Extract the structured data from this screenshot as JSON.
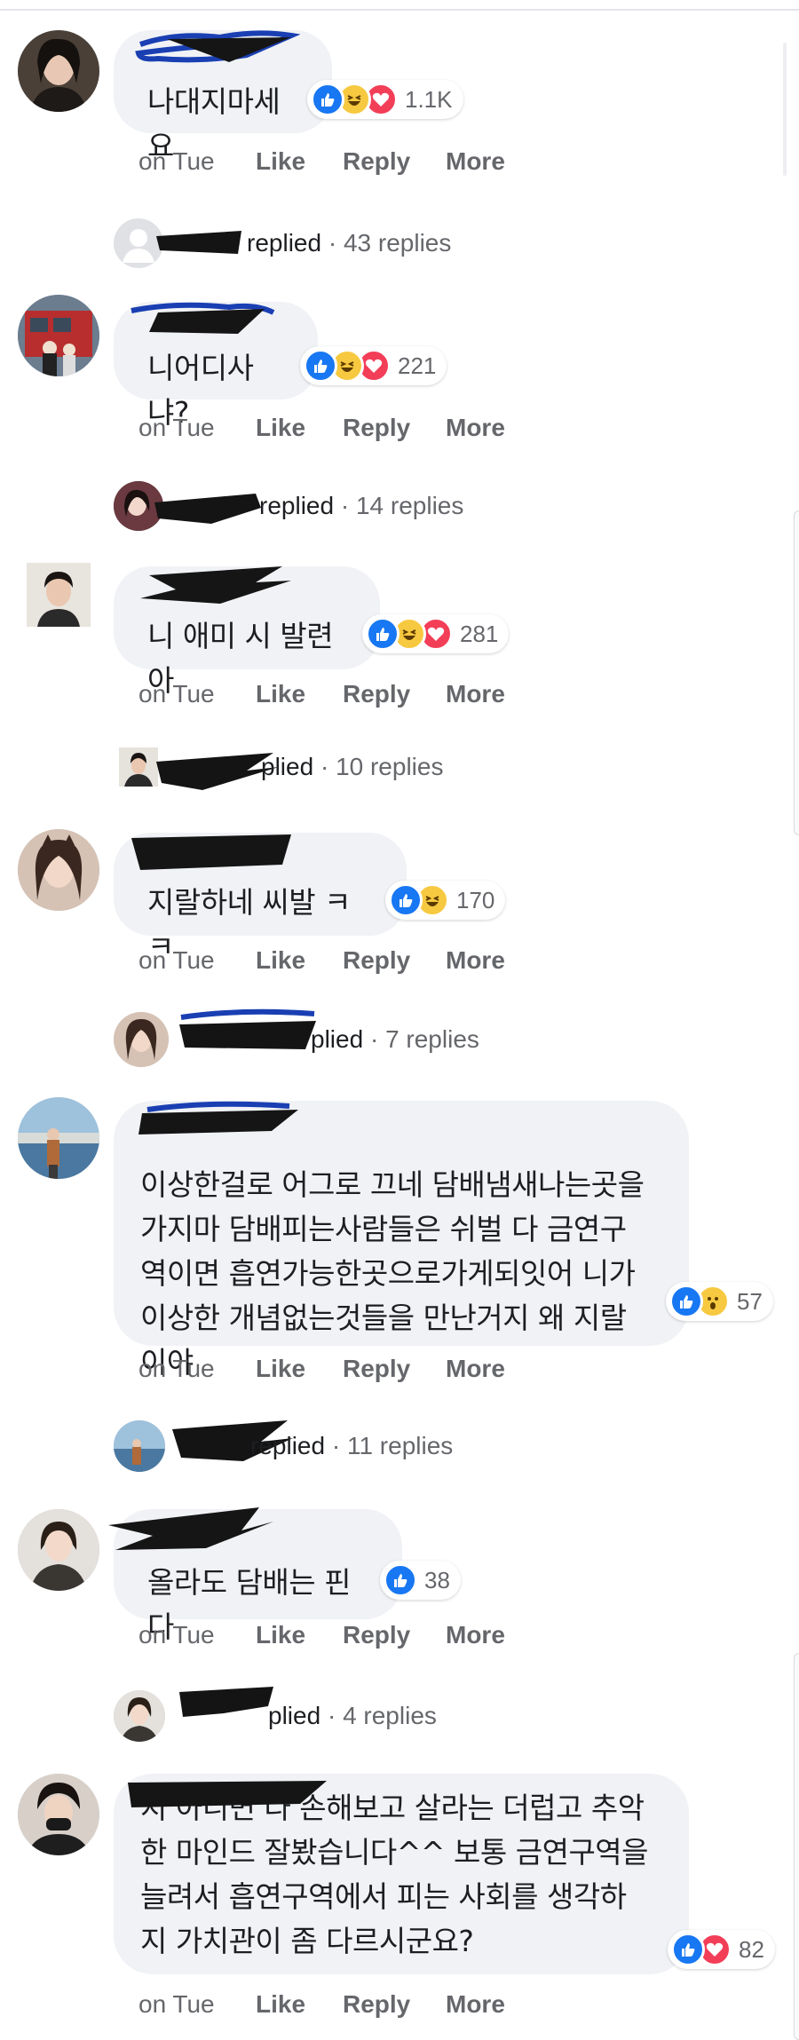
{
  "comments": [
    {
      "text": "나대지마세요",
      "reactions": [
        "like",
        "haha",
        "love"
      ],
      "count": "1.1K",
      "time": "on Tue",
      "like": "Like",
      "reply": "Reply",
      "more": "More",
      "replied_label": "replied",
      "replies_count": "43 replies",
      "avatar_bg": "#3a3230"
    },
    {
      "text": "니어디사냐?",
      "reactions": [
        "like",
        "haha",
        "love"
      ],
      "count": "221",
      "time": "on Tue",
      "like": "Like",
      "reply": "Reply",
      "more": "More",
      "replied_label": "replied",
      "replies_count": "14 replies",
      "avatar_bg": "#8a5a4e"
    },
    {
      "text": "니 애미 시 발련아",
      "reactions": [
        "like",
        "haha",
        "love"
      ],
      "count": "281",
      "time": "on Tue",
      "like": "Like",
      "reply": "Reply",
      "more": "More",
      "replied_label": "plied",
      "replies_count": "10 replies",
      "avatar_bg": "#d8d2c8"
    },
    {
      "text": "지랄하네 씨발 ㅋ ㅋ",
      "reactions": [
        "like",
        "haha"
      ],
      "count": "170",
      "time": "on Tue",
      "like": "Like",
      "reply": "Reply",
      "more": "More",
      "replied_label": "plied",
      "replies_count": "7 replies",
      "avatar_bg": "#c39a86"
    },
    {
      "text": "이상한걸로 어그로 끄네 담배냄새나는곳을\n가지마 담배피는사람들은 쉬벌 다 금연구\n역이면 흡연가능한곳으로가게되잇어 니가\n이상한 개념없는것들을 만난거지 왜 지랄\n이야",
      "reactions": [
        "like",
        "wow"
      ],
      "count": "57",
      "time": "on Tue",
      "like": "Like",
      "reply": "Reply",
      "more": "More",
      "replied_label": "replied",
      "replies_count": "11 replies",
      "avatar_bg": "#7fa3c4"
    },
    {
      "text": "올라도 담배는 핀다",
      "reactions": [
        "like"
      ],
      "count": "38",
      "time": "on Tue",
      "like": "Like",
      "reply": "Reply",
      "more": "More",
      "replied_label": "plied",
      "replies_count": "4 replies",
      "avatar_bg": "#d9d4cf"
    },
    {
      "text": "지 아니면 다 손해보고 살라는 더럽고 추악\n한 마인드 잘봤습니다^^ 보통 금연구역을\n늘려서 흡연구역에서 피는 사회를 생각하\n지 가치관이 좀 다르시군요?",
      "reactions": [
        "like",
        "love"
      ],
      "count": "82",
      "time": "on Tue",
      "like": "Like",
      "reply": "Reply",
      "more": "More",
      "avatar_bg": "#2d2724"
    }
  ],
  "colors": {
    "like": "#1877f2",
    "haha": "#f7c940",
    "love": "#f33e58",
    "bubble": "#f0f2f5",
    "meta": "#65676b",
    "scribble": "#141414",
    "scribble_blue": "#1a3fb3"
  }
}
